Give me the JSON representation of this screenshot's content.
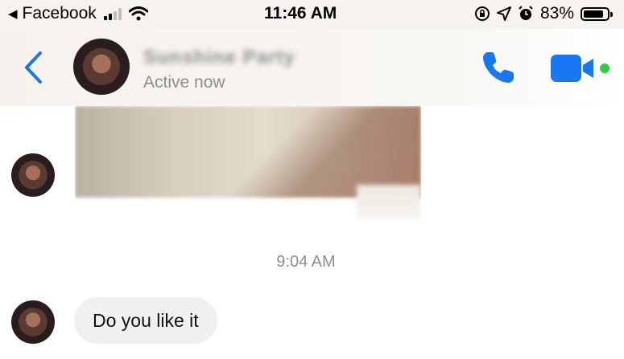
{
  "status_bar": {
    "back_app": "Facebook",
    "time": "11:46 AM",
    "battery": "83%",
    "icons": [
      "signal-icon",
      "wifi-icon",
      "orientation-lock-icon",
      "location-icon",
      "alarm-icon",
      "battery-icon"
    ],
    "signal_bars_on": 2,
    "signal_bars_total": 4,
    "battery_level": 0.83
  },
  "header": {
    "contact_name": "Sunshine Party",
    "status": "Active now",
    "accent_color": "#1877f2",
    "online_color": "#2ecc40",
    "icons": [
      "back-chevron-icon",
      "phone-icon",
      "video-camera-icon"
    ]
  },
  "messages": {
    "timestamp": "9:04 AM",
    "items": [
      {
        "type": "photo",
        "from": "contact"
      },
      {
        "type": "text",
        "from": "contact",
        "text": "Do you like it"
      }
    ]
  }
}
